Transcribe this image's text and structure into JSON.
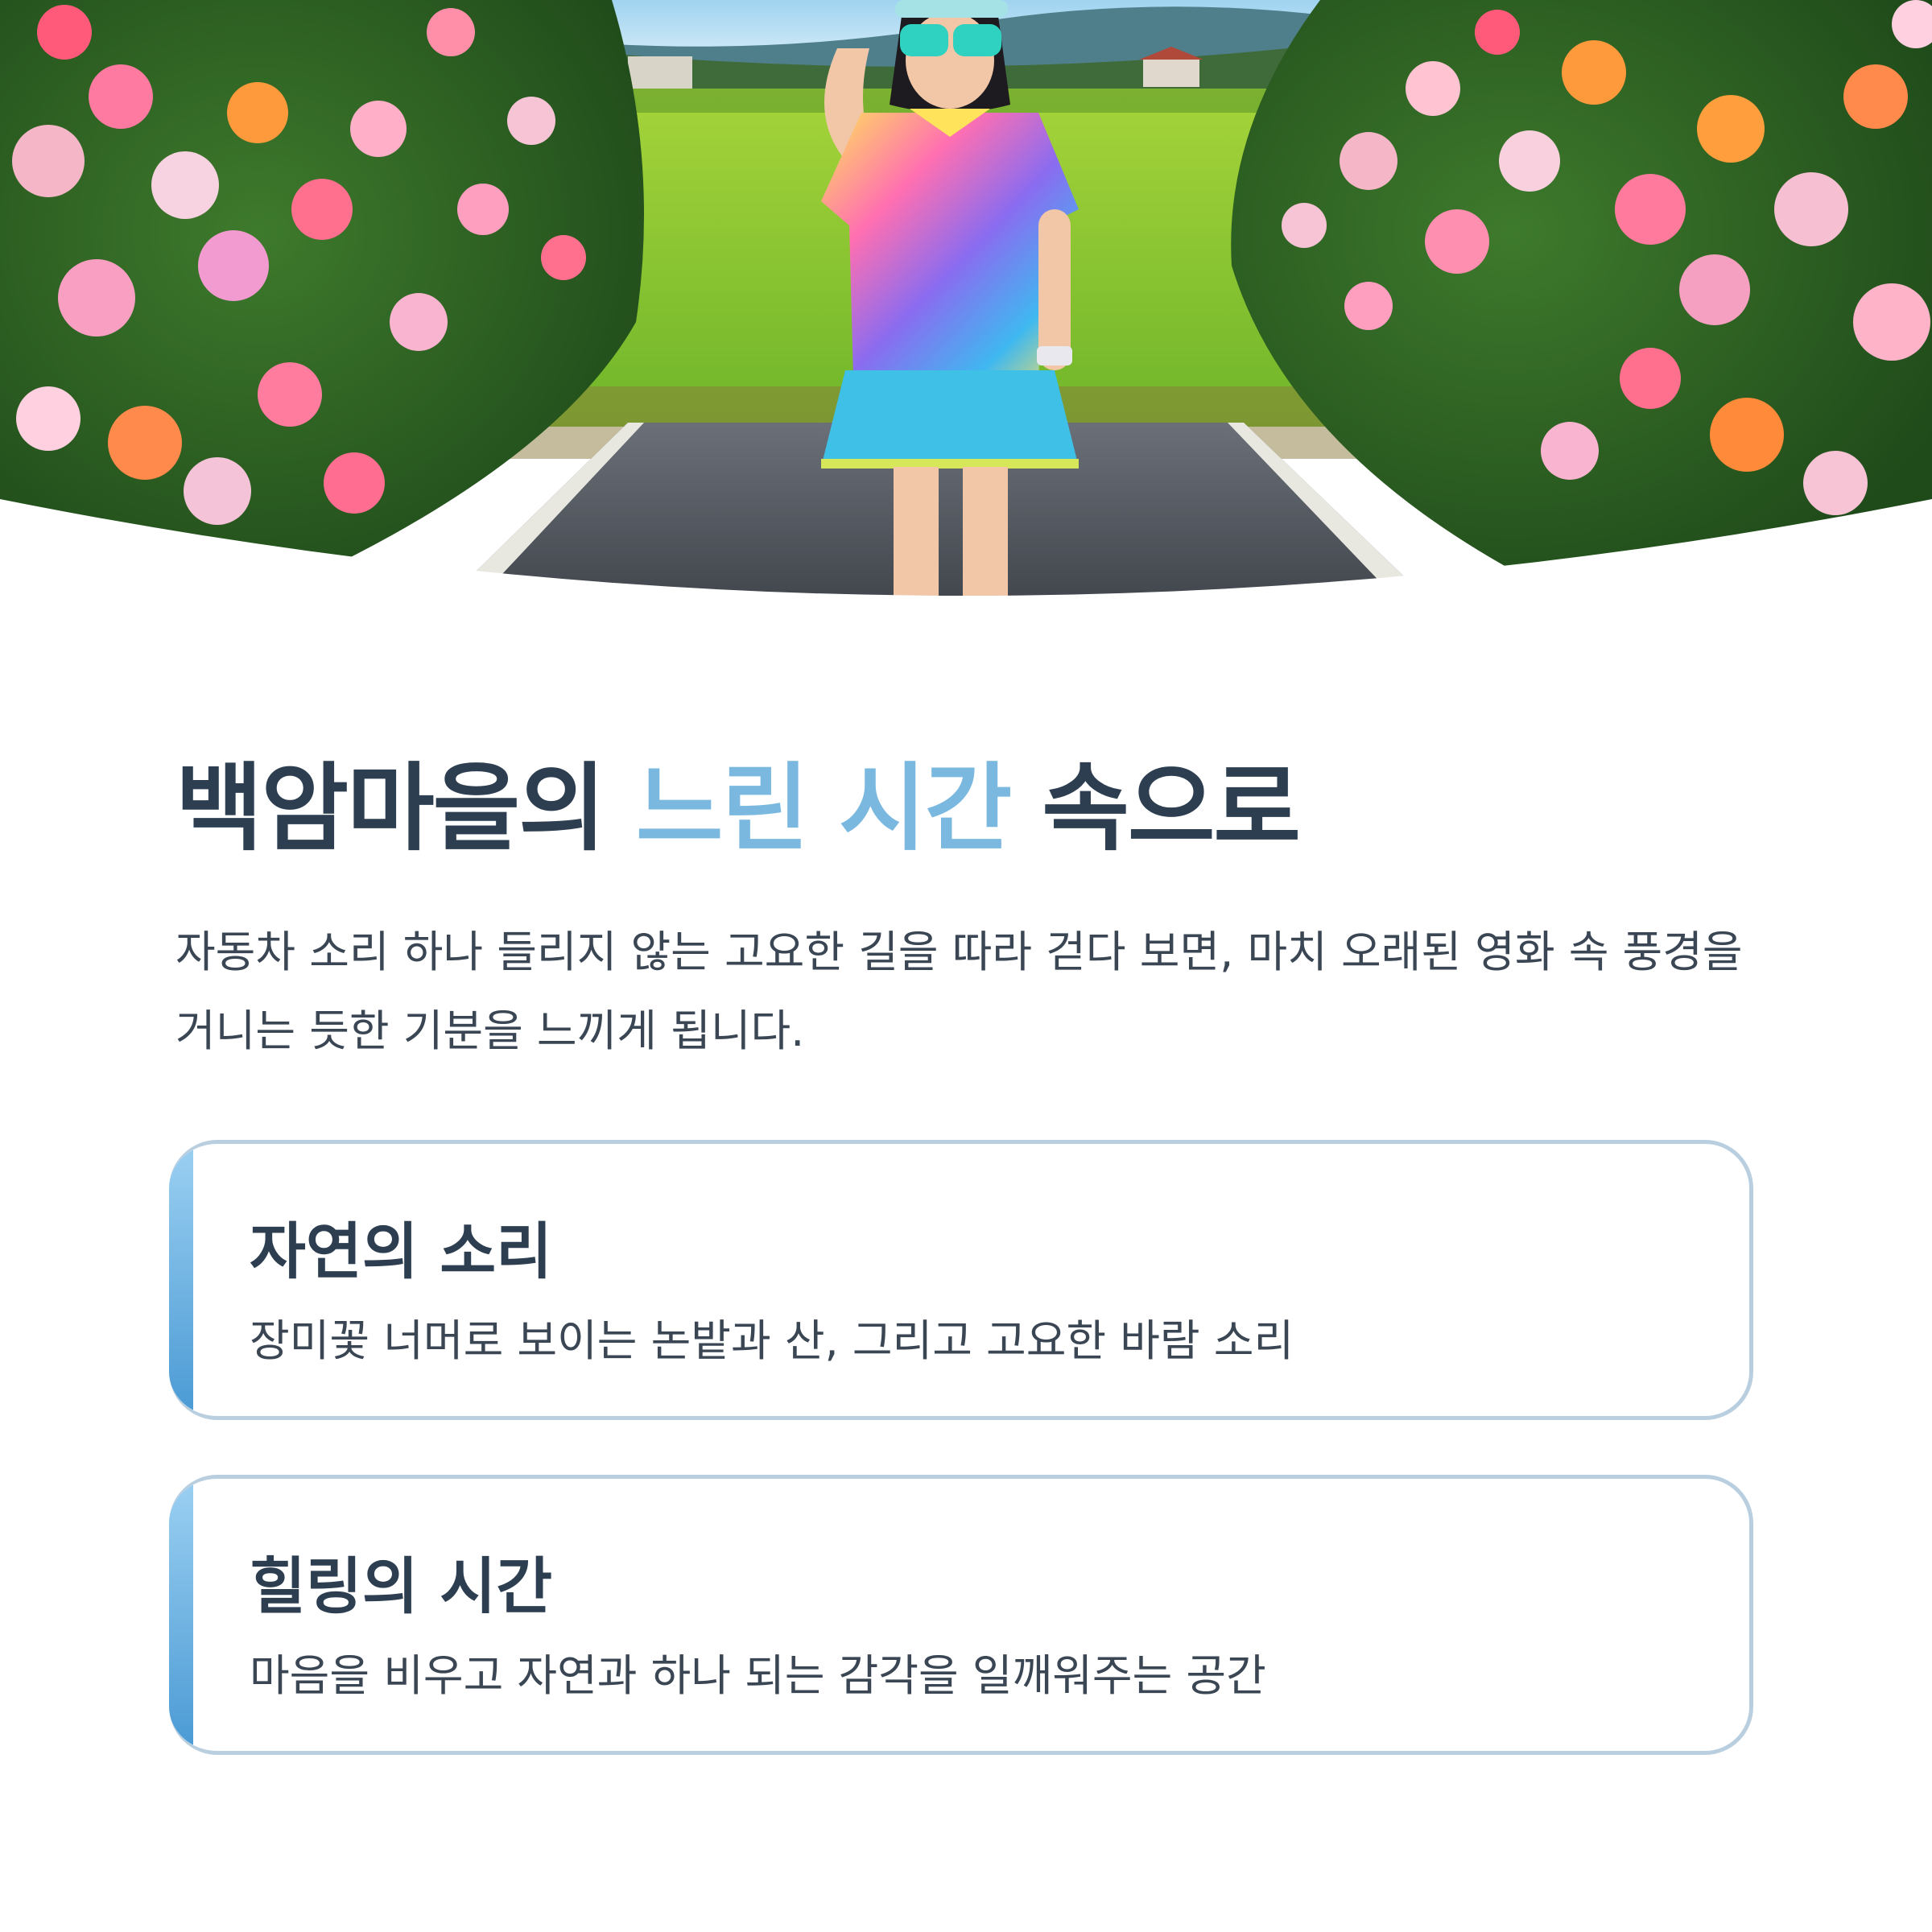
{
  "hero": {
    "image_description_icon": "photo-girl-rose-path"
  },
  "headline": {
    "part1": "백암마을의 ",
    "accent": "느린 시간",
    "part2": " 속으로"
  },
  "intro": "자동차 소리 하나 들리지 않는 고요한 길을 따라 걷다 보면, 마치 오래된 영화 속 풍경을 거니는 듯한 기분을 느끼게 됩니다.",
  "cards": [
    {
      "title": "자연의 소리",
      "text": "장미꽃 너머로 보이는 논밭과 산, 그리고 고요한 바람 소리"
    },
    {
      "title": "힐링의 시간",
      "text": "마음을 비우고 자연과 하나 되는 감각을 일깨워주는 공간"
    }
  ],
  "colors": {
    "heading": "#2c3e50",
    "accent": "#7ab8e0",
    "body": "#3a4654",
    "card_border": "#b9cfe0",
    "card_bar": "#4a9ad4"
  }
}
